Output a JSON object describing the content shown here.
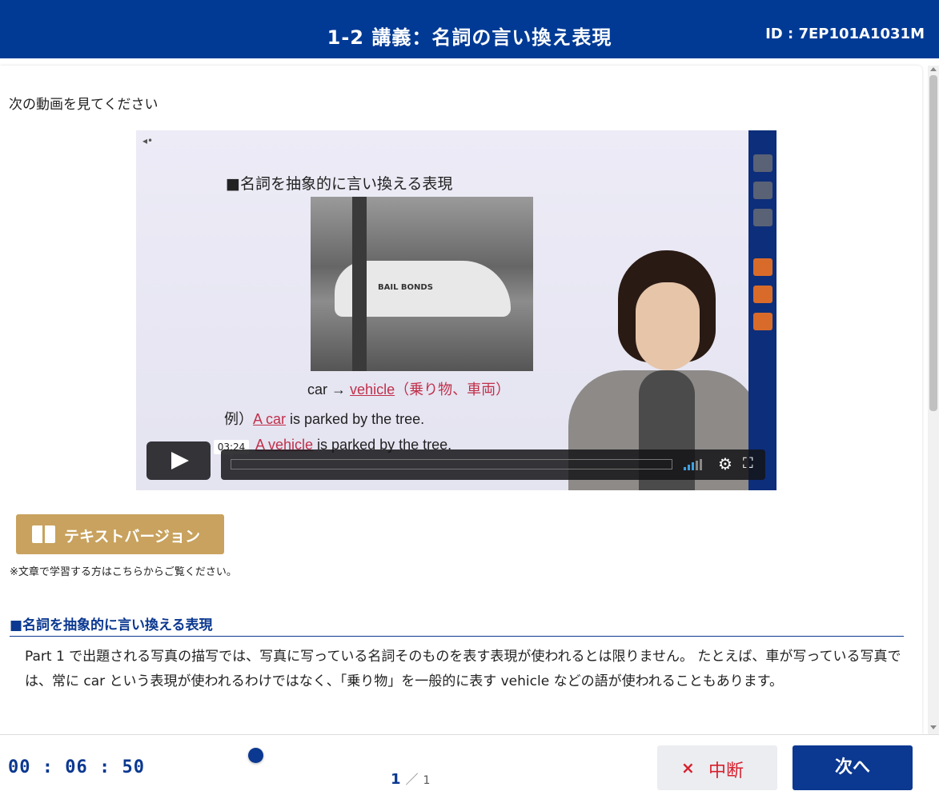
{
  "header": {
    "title": "1-2 講義：名詞の言い換え表現",
    "id_text": "ID : 7EP101A1031M",
    "background_color": "#003a95"
  },
  "main": {
    "instruction": "次の動画を見てください",
    "video": {
      "slide_title": "■名詞を抽象的に言い換える表現",
      "photo_text": "BAIL BONDS",
      "line1_word": "car",
      "line1_arrow": "→",
      "line1_red": "vehicle",
      "line1_jp": "（乗り物、車両）",
      "line2_prefix": "例）",
      "line2_red": "A car",
      "line2_rest": " is parked by the tree.",
      "line3_red": "A vehicle",
      "line3_rest": " is parked by the tree.",
      "time_tooltip": "03:24",
      "play_icon": "play-icon",
      "gear_glyph": "⚙",
      "fullscreen_glyph": "⛶",
      "volume_icon": "volume-bars-icon"
    },
    "text_version": {
      "label": "テキストバージョン",
      "icon": "book-icon",
      "color": "#c8a25e"
    },
    "note": "※文章で学習する方はこちらからご覧ください。",
    "section_heading": "■名詞を抽象的に言い換える表現",
    "paragraph": "Part 1 で出題される写真の描写では、写真に写っている名詞そのものを表す表現が使われるとは限りません。 たとえば、車が写っている写真では、常に car という表現が使われるわけではなく、「乗り物」を一般的に表す vehicle などの語が使われることもあります。"
  },
  "footer": {
    "timer": "00 : 06 : 50",
    "page_current": "1",
    "page_separator": "／",
    "page_total": "1",
    "interrupt_icon": "×",
    "interrupt_label": "中断",
    "next_label": "次へ",
    "accent_color": "#0b3890",
    "interrupt_color": "#d7202d"
  }
}
